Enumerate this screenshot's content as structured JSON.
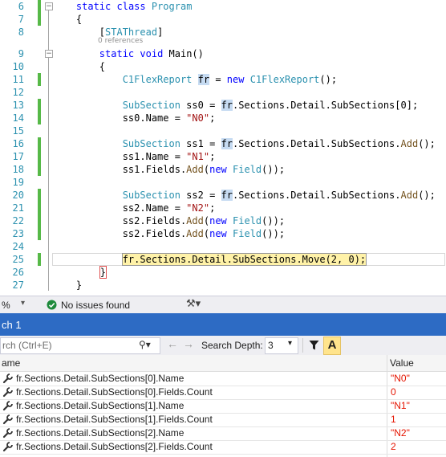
{
  "editor": {
    "lines": [
      {
        "n": "6",
        "parts": [
          {
            "t": "    "
          },
          {
            "t": "static",
            "c": "kw"
          },
          {
            "t": " "
          },
          {
            "t": "class",
            "c": "kw"
          },
          {
            "t": " "
          },
          {
            "t": "Program",
            "c": "ty"
          }
        ]
      },
      {
        "n": "7",
        "parts": [
          {
            "t": "    {"
          }
        ]
      },
      {
        "n": "8",
        "parts": [
          {
            "t": "        ["
          },
          {
            "t": "STAThread",
            "c": "ty"
          },
          {
            "t": "]"
          }
        ]
      },
      {
        "n": "9",
        "parts": [
          {
            "t": "        "
          },
          {
            "t": "static",
            "c": "kw"
          },
          {
            "t": " "
          },
          {
            "t": "void",
            "c": "kw"
          },
          {
            "t": " Main()"
          }
        ]
      },
      {
        "n": "10",
        "parts": [
          {
            "t": "        {"
          }
        ]
      },
      {
        "n": "11",
        "parts": [
          {
            "t": "            "
          },
          {
            "t": "C1FlexReport",
            "c": "ty"
          },
          {
            "t": " "
          },
          {
            "t": "fr",
            "c": "sel"
          },
          {
            "t": " = "
          },
          {
            "t": "new",
            "c": "kw"
          },
          {
            "t": " "
          },
          {
            "t": "C1FlexReport",
            "c": "ty"
          },
          {
            "t": "();"
          }
        ]
      },
      {
        "n": "12",
        "parts": []
      },
      {
        "n": "13",
        "parts": [
          {
            "t": "            "
          },
          {
            "t": "SubSection",
            "c": "ty"
          },
          {
            "t": " ss0 = "
          },
          {
            "t": "fr",
            "c": "sel"
          },
          {
            "t": ".Sections.Detail.SubSections[0];"
          }
        ]
      },
      {
        "n": "14",
        "parts": [
          {
            "t": "            ss0.Name = "
          },
          {
            "t": "\"N0\"",
            "c": "str"
          },
          {
            "t": ";"
          }
        ]
      },
      {
        "n": "15",
        "parts": []
      },
      {
        "n": "16",
        "parts": [
          {
            "t": "            "
          },
          {
            "t": "SubSection",
            "c": "ty"
          },
          {
            "t": " ss1 = "
          },
          {
            "t": "fr",
            "c": "sel"
          },
          {
            "t": ".Sections.Detail.SubSections."
          },
          {
            "t": "Add",
            "c": "meth"
          },
          {
            "t": "();"
          }
        ]
      },
      {
        "n": "17",
        "parts": [
          {
            "t": "            ss1.Name = "
          },
          {
            "t": "\"N1\"",
            "c": "str"
          },
          {
            "t": ";"
          }
        ]
      },
      {
        "n": "18",
        "parts": [
          {
            "t": "            ss1.Fields."
          },
          {
            "t": "Add",
            "c": "meth"
          },
          {
            "t": "("
          },
          {
            "t": "new",
            "c": "kw"
          },
          {
            "t": " "
          },
          {
            "t": "Field",
            "c": "ty"
          },
          {
            "t": "());"
          }
        ]
      },
      {
        "n": "19",
        "parts": []
      },
      {
        "n": "20",
        "parts": [
          {
            "t": "            "
          },
          {
            "t": "SubSection",
            "c": "ty"
          },
          {
            "t": " ss2 = "
          },
          {
            "t": "fr",
            "c": "sel"
          },
          {
            "t": ".Sections.Detail.SubSections."
          },
          {
            "t": "Add",
            "c": "meth"
          },
          {
            "t": "();"
          }
        ]
      },
      {
        "n": "21",
        "parts": [
          {
            "t": "            ss2.Name = "
          },
          {
            "t": "\"N2\"",
            "c": "str"
          },
          {
            "t": ";"
          }
        ]
      },
      {
        "n": "22",
        "parts": [
          {
            "t": "            ss2.Fields."
          },
          {
            "t": "Add",
            "c": "meth"
          },
          {
            "t": "("
          },
          {
            "t": "new",
            "c": "kw"
          },
          {
            "t": " "
          },
          {
            "t": "Field",
            "c": "ty"
          },
          {
            "t": "());"
          }
        ]
      },
      {
        "n": "23",
        "parts": [
          {
            "t": "            ss2.Fields."
          },
          {
            "t": "Add",
            "c": "meth"
          },
          {
            "t": "("
          },
          {
            "t": "new",
            "c": "kw"
          },
          {
            "t": " "
          },
          {
            "t": "Field",
            "c": "ty"
          },
          {
            "t": "());"
          }
        ]
      },
      {
        "n": "24",
        "parts": []
      },
      {
        "n": "25",
        "parts": [
          {
            "t": "            "
          },
          {
            "t": "fr.Sections.Detail.SubSections.Move(2, 0);",
            "c": "hl"
          }
        ]
      },
      {
        "n": "26",
        "parts": [
          {
            "t": "        "
          },
          {
            "t": "}",
            "c": "brace"
          }
        ]
      },
      {
        "n": "27",
        "parts": [
          {
            "t": "    }"
          }
        ]
      }
    ],
    "references_label": "0 references"
  },
  "status": {
    "zoom": "%",
    "issues": "No issues found"
  },
  "watch": {
    "title": "ch 1",
    "search_placeholder": "rch (Ctrl+E)",
    "search_depth_label": "Search Depth:",
    "search_depth_value": "3",
    "col_name": "ame",
    "col_value": "Value",
    "rows": [
      {
        "name": "fr.Sections.Detail.SubSections[0].Name",
        "value": "\"N0\""
      },
      {
        "name": "fr.Sections.Detail.SubSections[0].Fields.Count",
        "value": "0"
      },
      {
        "name": "fr.Sections.Detail.SubSections[1].Name",
        "value": "\"N1\""
      },
      {
        "name": "fr.Sections.Detail.SubSections[1].Fields.Count",
        "value": "1"
      },
      {
        "name": "fr.Sections.Detail.SubSections[2].Name",
        "value": "\"N2\""
      },
      {
        "name": "fr.Sections.Detail.SubSections[2].Fields.Count",
        "value": "2"
      }
    ]
  }
}
